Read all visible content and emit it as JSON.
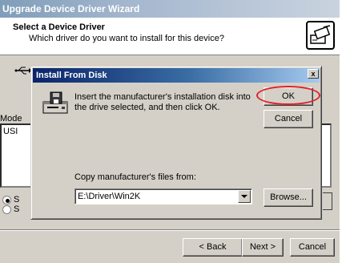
{
  "wizard": {
    "title": "Upgrade Device Driver Wizard",
    "header_title": "Select a Device Driver",
    "header_subtitle": "Which driver do you want to install for this device?",
    "background_label_partial": "Mode",
    "background_list_item_partial": "USI",
    "radio_1_partial": "S",
    "radio_2_partial": "S",
    "back_label": "< Back",
    "next_label": "Next >",
    "cancel_label": "Cancel"
  },
  "dialog": {
    "title": "Install From Disk",
    "close_glyph": "x",
    "message": "Insert the manufacturer's installation disk into the drive selected, and then click OK.",
    "ok_label": "OK",
    "cancel_label": "Cancel",
    "copy_label": "Copy manufacturer's files from:",
    "path_value": "E:\\Driver\\Win2K",
    "browse_label": "Browse...",
    "highlight_color": "#e0202a"
  },
  "icons": {
    "wizard_header": "hardware-wizard-icon",
    "usb": "usb-icon",
    "disk": "floppy-disk-drive-icon",
    "dropdown": "chevron-down-icon"
  }
}
